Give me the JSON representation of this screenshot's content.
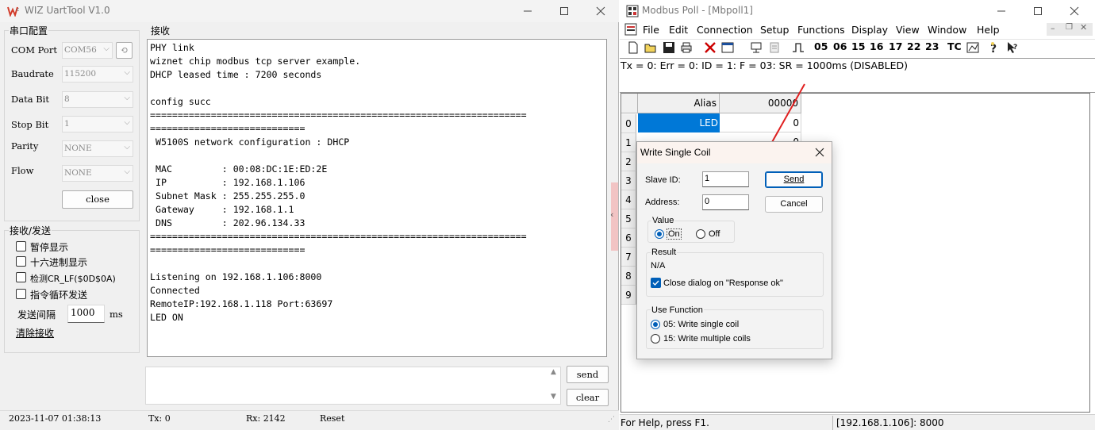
{
  "uart": {
    "title": "WIZ UartTool V1.0",
    "serial_group_title": "串口配置",
    "com_port": {
      "label": "COM Port",
      "value": "COM56"
    },
    "baudrate": {
      "label": "Baudrate",
      "value": "115200"
    },
    "data_bit": {
      "label": "Data Bit",
      "value": "8"
    },
    "stop_bit": {
      "label": "Stop Bit",
      "value": "1"
    },
    "parity": {
      "label": "Parity",
      "value": "NONE"
    },
    "flow": {
      "label": "Flow",
      "value": "NONE"
    },
    "close_label": "close",
    "rxtx_group_title": "接收/发送",
    "options": [
      "暂停显示",
      "十六进制显示",
      "检测CR_LF($0D$0A)",
      "指令循环发送"
    ],
    "interval_label": "发送间隔",
    "interval_value": "1000",
    "interval_unit": "ms",
    "clear_recv_label": "清除接收",
    "recv_group_title": "接收",
    "recv_lines": [
      "PHY link",
      "wiznet chip modbus tcp server example.",
      "DHCP leased time : 7200 seconds",
      "",
      "config succ",
      "====================================================================",
      "============================",
      " W5100S network configuration : DHCP",
      "",
      " MAC         : 00:08:DC:1E:ED:2E",
      " IP          : 192.168.1.106",
      " Subnet Mask : 255.255.255.0",
      " Gateway     : 192.168.1.1",
      " DNS         : 202.96.134.33",
      "====================================================================",
      "============================",
      "",
      "Listening on 192.168.1.106:8000",
      "Connected",
      "RemoteIP:192.168.1.118 Port:63697",
      "LED ON"
    ],
    "send_label": "send",
    "clear_label": "clear",
    "status": {
      "datetime": "2023-11-07 01:38:13",
      "tx": "Tx: 0",
      "rx": "Rx: 2142",
      "reset": "Reset"
    }
  },
  "modbus": {
    "title": "Modbus Poll - [Mbpoll1]",
    "menu": [
      "File",
      "Edit",
      "Connection",
      "Setup",
      "Functions",
      "Display",
      "View",
      "Window",
      "Help"
    ],
    "toolbar_codes": [
      "05",
      "06",
      "15",
      "16",
      "17",
      "22",
      "23"
    ],
    "toolbar_tc": "TC",
    "status_line": "Tx = 0: Err = 0: ID = 1: F = 03: SR = 1000ms  (DISABLED)",
    "grid": {
      "header_alias": "Alias",
      "header_addr": "00000",
      "rows": [
        "0",
        "1",
        "2",
        "3",
        "4",
        "5",
        "6",
        "7",
        "8",
        "9"
      ],
      "row0_alias": "LED",
      "row0_value": "0",
      "row1_value": "0"
    },
    "statusbar_left": "For Help, press F1.",
    "statusbar_right": "[192.168.1.106]: 8000"
  },
  "dialog": {
    "title": "Write Single Coil",
    "slave_id_label": "Slave ID:",
    "slave_id_value": "1",
    "address_label": "Address:",
    "address_value": "0",
    "send_label": "Send",
    "cancel_label": "Cancel",
    "value_group": "Value",
    "on_label": "On",
    "off_label": "Off",
    "result_group": "Result",
    "result_value": "N/A",
    "close_on_ok_label": "Close dialog on \"Response ok\"",
    "use_function_group": "Use Function",
    "func_05": "05: Write single coil",
    "func_15": "15: Write multiple coils"
  },
  "colors": {
    "accent": "#0078d7",
    "selection": "#0078d7",
    "annotation_arrow": "#e02020"
  }
}
